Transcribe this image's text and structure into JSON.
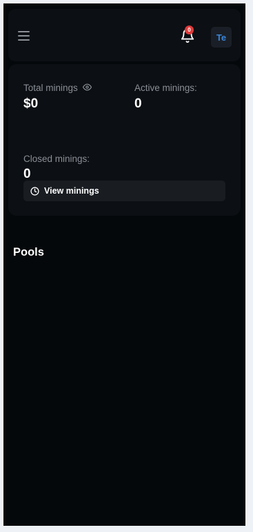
{
  "header": {
    "menu_icon": "hamburger-icon",
    "bell_icon": "bell-icon",
    "notification_count": "0",
    "avatar_initials": "Te"
  },
  "stats": {
    "total_label": "Total minings",
    "total_value": "$0",
    "active_label": "Active minings:",
    "active_value": "0",
    "closed_label": "Closed minings:",
    "closed_value": "0",
    "view_button_label": "View minings",
    "eye_icon": "eye-icon",
    "clock_icon": "clock-icon"
  },
  "pools": {
    "title": "Pools"
  },
  "colors": {
    "background": "#05080b",
    "card": "#0c0f13",
    "badge": "#e03a3a",
    "avatar_text": "#3b86d9"
  }
}
